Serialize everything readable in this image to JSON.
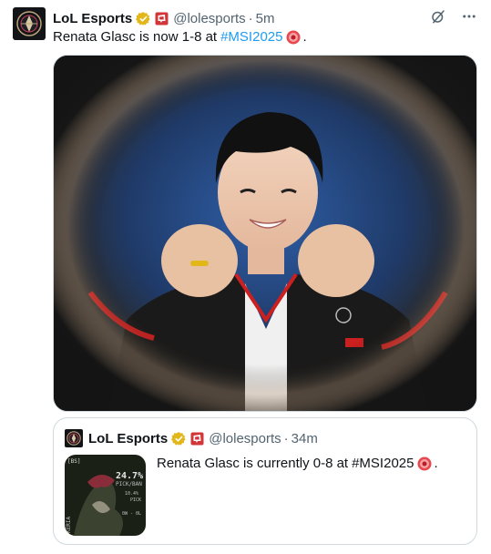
{
  "tweet": {
    "author_name": "LoL Esports",
    "handle": "@lolesports",
    "separator": "·",
    "time": "5m",
    "text": "Renata Glasc is now 1-8 at",
    "hashtag": "#MSI2025",
    "trailing": ".",
    "icons": {
      "avatar": "lol-esports-logo",
      "verified": "gold-verified-badge-icon",
      "affiliate": "riot-affiliate-icon",
      "grok": "grok-icon",
      "more": "more-options-icon",
      "emoji": "red-emoji-icon"
    },
    "media": {
      "kind": "photo",
      "subject": "player in team jacket with fists raised, framed by lens blur",
      "colors": {
        "background": "#1f3a68",
        "frame": "#2a2a2a",
        "jacket": "#1a1a1a",
        "accent": "#cc1f1f"
      }
    }
  },
  "quote": {
    "author_name": "LoL Esports",
    "handle": "@lolesports",
    "separator": "·",
    "time": "34m",
    "text": "Renata Glasc is currently 0-8 at",
    "hashtag": "#MSI2025",
    "trailing": ".",
    "thumbnail": {
      "corner_label": "[BS]",
      "stat_big": "24.7%",
      "stat_big_label": "PICK/BAN",
      "stat_small": "10.4%",
      "stat_small_label": "PICK",
      "record": "0W - 0L",
      "side_text": "KERIA"
    }
  },
  "colors": {
    "text": "#0f1419",
    "muted": "#536471",
    "link": "#1d9bf0",
    "border": "#cfd9de",
    "badge_gold": "#e2b719",
    "affiliate_red": "#d13639"
  }
}
